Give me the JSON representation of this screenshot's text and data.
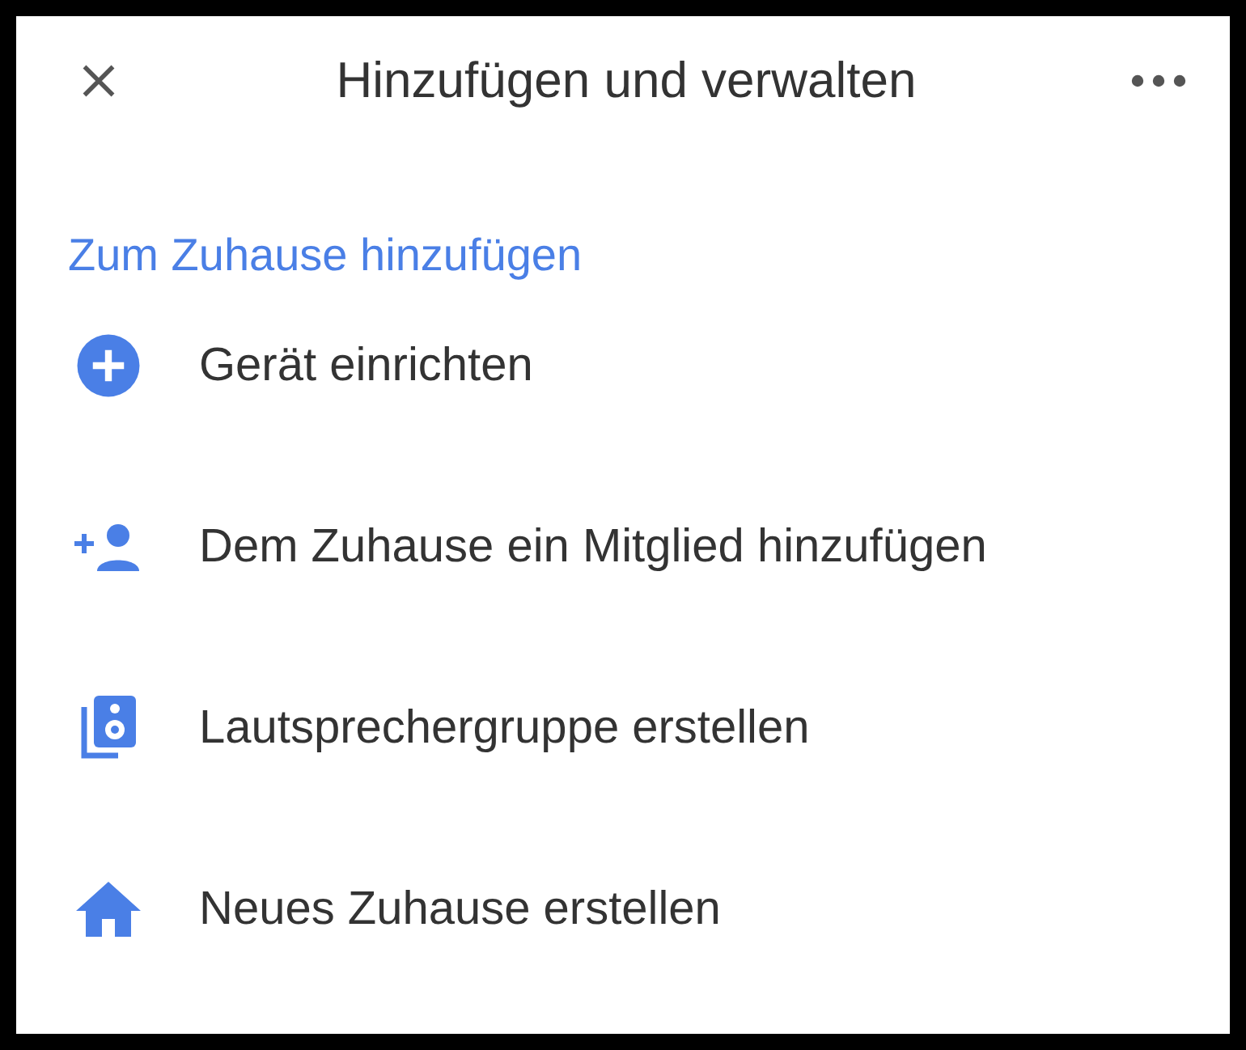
{
  "header": {
    "title": "Hinzufügen und verwalten"
  },
  "section": {
    "title": "Zum Zuhause hinzufügen"
  },
  "items": [
    {
      "kind": "add",
      "label": "Gerät einrichten"
    },
    {
      "kind": "person-add",
      "label": "Dem Zuhause ein Mitglied hinzufügen"
    },
    {
      "kind": "speaker-group",
      "label": "Lautsprechergruppe erstellen"
    },
    {
      "kind": "home",
      "label": "Neues Zuhause erstellen"
    }
  ]
}
